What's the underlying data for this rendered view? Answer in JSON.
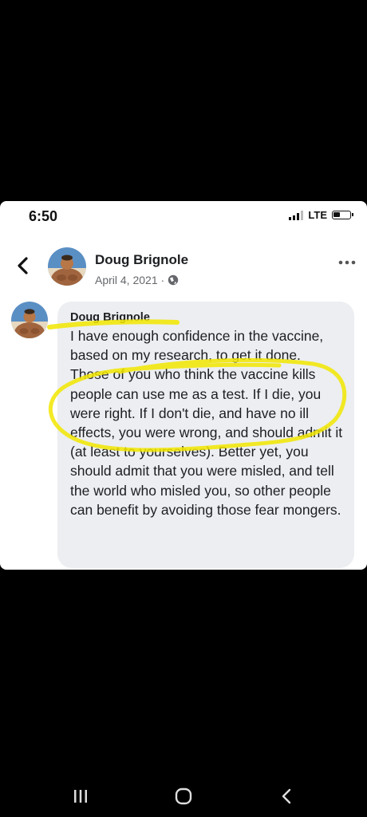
{
  "status_bar": {
    "time": "6:50",
    "network": "LTE"
  },
  "post_header": {
    "author_name": "Doug Brignole",
    "date": "April 4, 2021 ·",
    "back_icon": "chevron-left-icon",
    "privacy_icon": "globe-icon",
    "more_icon": "more-horizontal-icon"
  },
  "comment": {
    "author_name": "Doug Brignole",
    "text": "I have enough confidence in the vaccine, based on my research, to get it done. Those of you who think the vaccine kills people can use me as a test. If I die, you were right. If I don't die, and have no ill effects, you were wrong, and should admit it (at least to yourselves). Better yet, you should admit that you were misled, and tell the world who misled you, so other people can benefit by avoiding those fear mongers."
  },
  "annotation_color": "#f2e600",
  "bubble_color": "#eceef1",
  "system_nav": {
    "recents_icon": "recents-icon",
    "home_icon": "home-icon",
    "back_icon": "back-arrow-icon"
  }
}
